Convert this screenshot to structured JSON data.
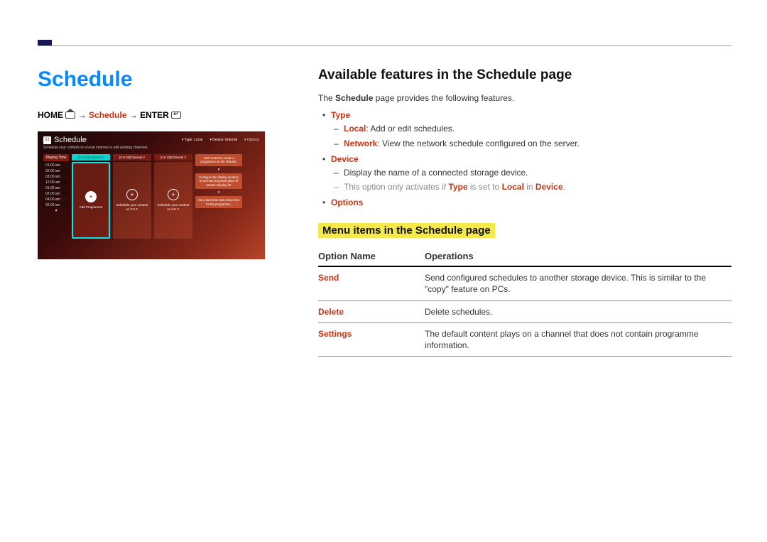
{
  "leftCol": {
    "title": "Schedule",
    "breadcrumb": {
      "home": "HOME",
      "arrow1": " → ",
      "schedule": "Schedule",
      "arrow2": " → ",
      "enter": "ENTER"
    },
    "screenshot": {
      "calendarDay": "31",
      "title": "Schedule",
      "topOptions": {
        "type": "Type: Local",
        "device": "Device: Internal",
        "options": "Options"
      },
      "subtitle": "Schedule your content on a local channel or edit existing channels.",
      "timeHead": "Playing Time",
      "times": [
        "01:00 am",
        "02:00 am",
        "03:00 am",
        "12:00 am",
        "01:00 am",
        "02:00 am",
        "04:00 am",
        "05:00 am"
      ],
      "columns": [
        {
          "head": "[CH 01]Channel 1",
          "label": "Add Programme"
        },
        {
          "head": "[CH 02]Channel 2",
          "label": "Schedule your content on CH 2."
        },
        {
          "head": "[CH 03]Channel 3",
          "label": "Schedule your content on CH 3."
        }
      ],
      "tips": [
        "Add content to create a programme on the channel.",
        "Configure the display duration to set how long each piece of content will play for.",
        "Set a start time and a stop time for the programme."
      ]
    }
  },
  "rightCol": {
    "h2": "Available features in the Schedule page",
    "intro": {
      "pre": "The ",
      "bold": "Schedule",
      "post": " page provides the following features."
    },
    "features": {
      "type": {
        "label": "Type",
        "local": {
          "bold": "Local",
          "text": ": Add or edit schedules."
        },
        "network": {
          "bold": "Network",
          "text": ": View the network schedule configured on the server."
        }
      },
      "device": {
        "label": "Device",
        "line1": "Display the name of a connected storage device.",
        "line2": {
          "pre": "This option only activates if ",
          "b1": "Type",
          "mid": " is set to ",
          "b2": "Local",
          "mid2": " in ",
          "b3": "Device",
          "post": "."
        }
      },
      "options": {
        "label": "Options"
      }
    },
    "h3": "Menu items in the Schedule page",
    "table": {
      "headName": "Option Name",
      "headOps": "Operations",
      "rows": [
        {
          "name": "Send",
          "ops": "Send configured schedules to another storage device. This is similar to the \"copy\" feature on PCs."
        },
        {
          "name": "Delete",
          "ops": "Delete schedules."
        },
        {
          "name": "Settings",
          "ops": "The default content plays on a channel that does not contain programme information."
        }
      ]
    }
  }
}
